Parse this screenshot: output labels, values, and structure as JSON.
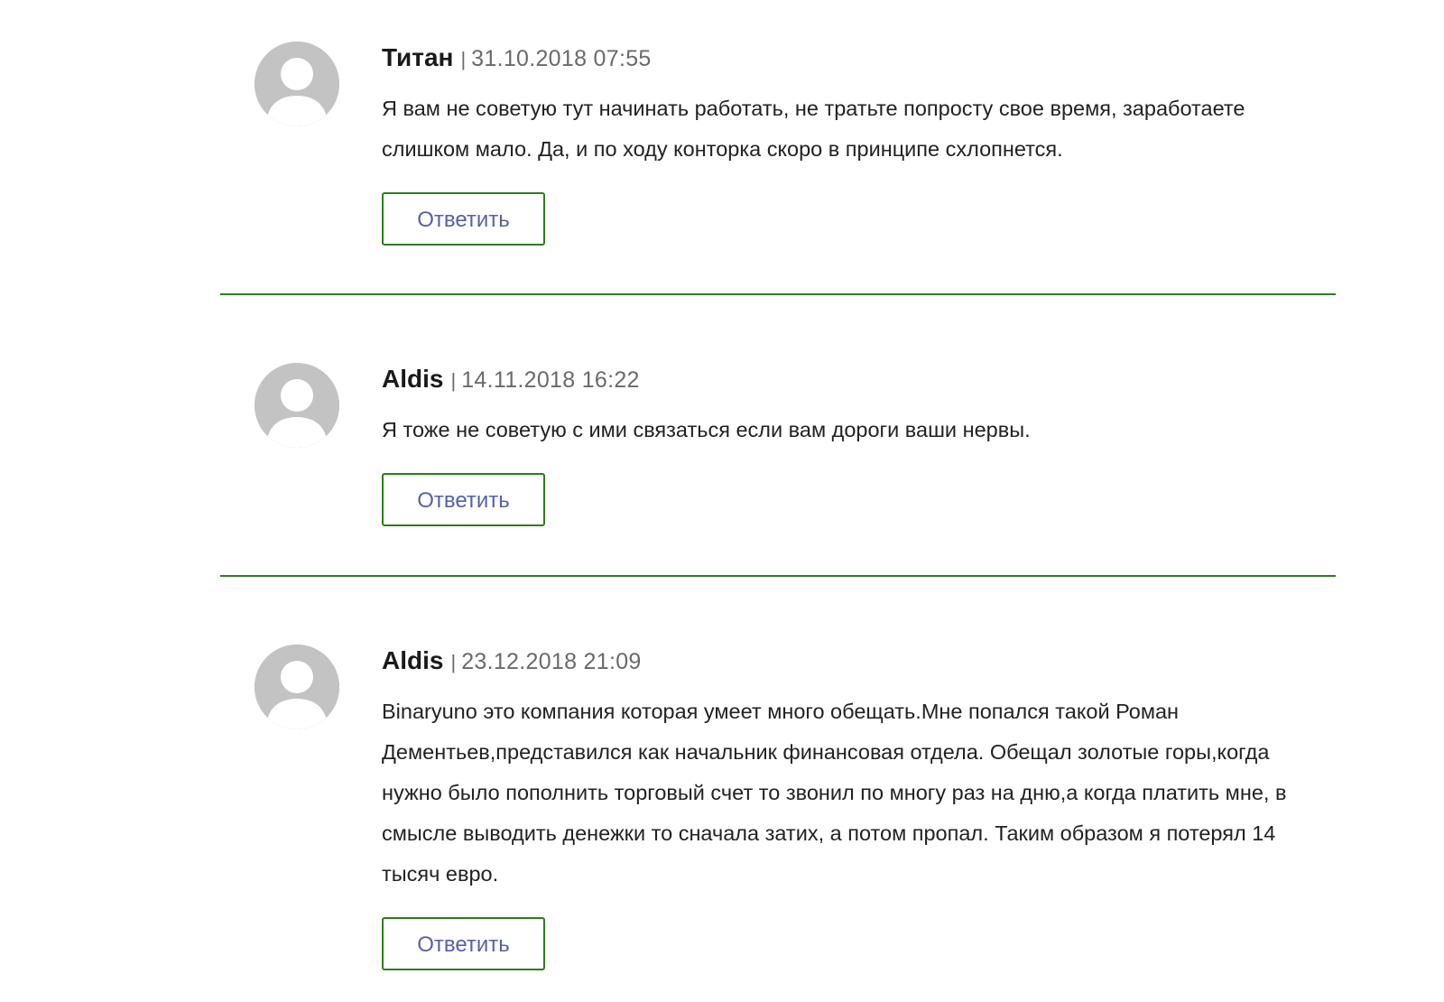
{
  "comments": [
    {
      "author": "Титан",
      "separator": "|",
      "date": "31.10.2018 07:55",
      "text": "Я вам не советую тут начинать работать, не тратьте попросту свое время, заработаете слишком мало. Да, и по ходу конторка скоро в принципе схлопнется.",
      "reply_label": "Ответить",
      "avatar_icon": "user-avatar-icon"
    },
    {
      "author": "Aldis",
      "separator": "|",
      "date": "14.11.2018 16:22",
      "text": "Я тоже не советую с ими связаться если вам дороги ваши нервы.",
      "reply_label": "Ответить",
      "avatar_icon": "user-avatar-icon"
    },
    {
      "author": "Aldis",
      "separator": "|",
      "date": "23.12.2018 21:09",
      "text": "Binaryuno это компания которая умеет много обещать.Мне попался такой Роман Дементьев,представился как начальник финансовая отдела. Обещал золотые горы,когда нужно было пополнить торговый счет то звонил по многу раз на дню,а когда платить мне, в смысле выводить денежки то сначала затих, а потом пропал. Таким образом я потерял 14 тысяч евро.",
      "reply_label": "Ответить",
      "avatar_icon": "user-avatar-icon"
    }
  ],
  "colors": {
    "accent_green": "#2d7d1b",
    "reply_text": "#5562a6",
    "avatar_gray": "#c3c3c3",
    "meta_gray": "#6a6a6a"
  }
}
